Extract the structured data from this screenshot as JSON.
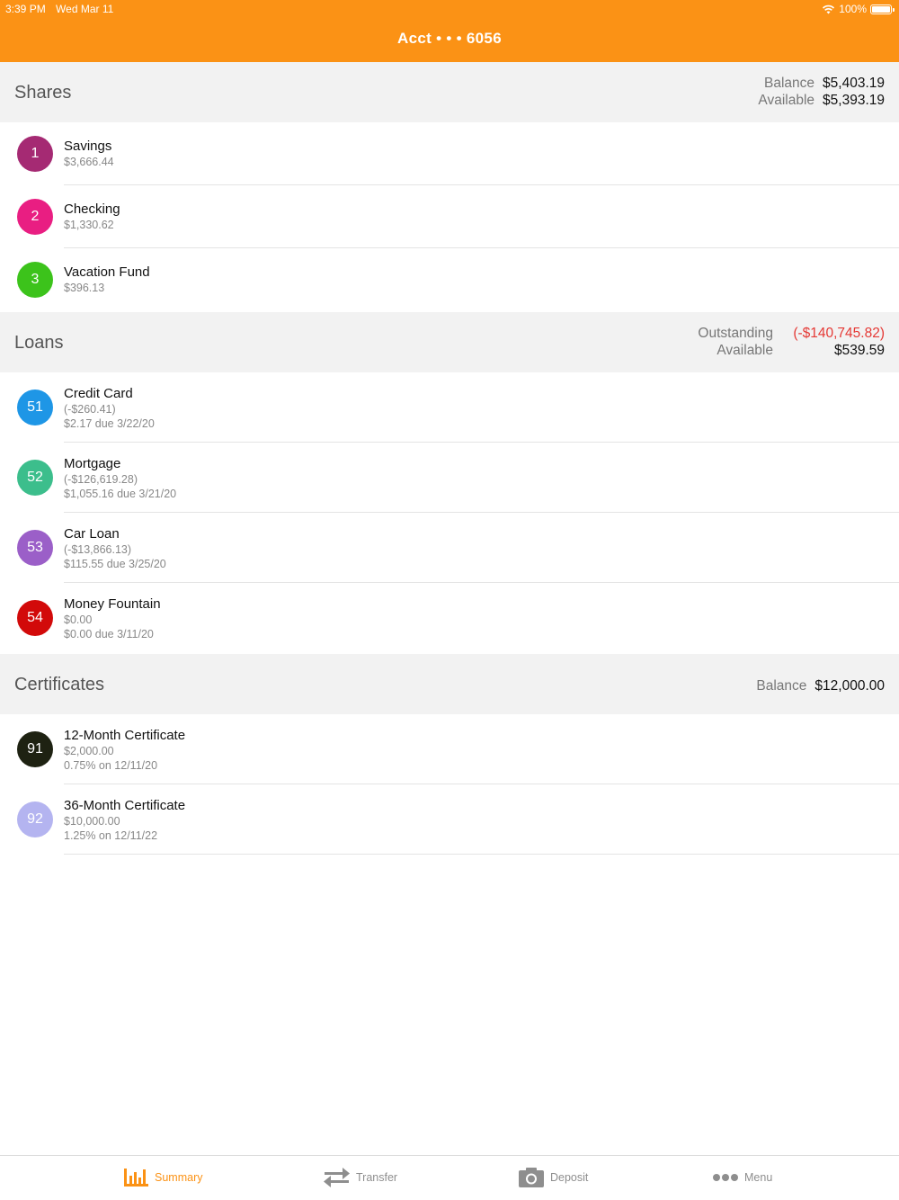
{
  "status_bar": {
    "time": "3:39 PM",
    "date": "Wed Mar 11",
    "battery": "100%"
  },
  "header": {
    "title": "Acct • • • 6056"
  },
  "colors": {
    "accent": "#fb9215",
    "negative": "#e53935"
  },
  "shares": {
    "title": "Shares",
    "balance_label": "Balance",
    "balance_value": "$5,403.19",
    "available_label": "Available",
    "available_value": "$5,393.19",
    "items": [
      {
        "num": "1",
        "name": "Savings",
        "line1": "$3,666.44",
        "color": "#a52a73"
      },
      {
        "num": "2",
        "name": "Checking",
        "line1": "$1,330.62",
        "color": "#e91e82"
      },
      {
        "num": "3",
        "name": "Vacation Fund",
        "line1": "$396.13",
        "color": "#3cc31b"
      }
    ]
  },
  "loans": {
    "title": "Loans",
    "outstanding_label": "Outstanding",
    "outstanding_value": "(-$140,745.82)",
    "available_label": "Available",
    "available_value": "$539.59",
    "items": [
      {
        "num": "51",
        "name": "Credit Card",
        "line1": "(-$260.41)",
        "line2": "$2.17 due 3/22/20",
        "color": "#1e96e6"
      },
      {
        "num": "52",
        "name": "Mortgage",
        "line1": "(-$126,619.28)",
        "line2": "$1,055.16 due 3/21/20",
        "color": "#3cbe8c"
      },
      {
        "num": "53",
        "name": "Car Loan",
        "line1": "(-$13,866.13)",
        "line2": "$115.55 due 3/25/20",
        "color": "#9b5fc8"
      },
      {
        "num": "54",
        "name": "Money Fountain",
        "line1": "$0.00",
        "line2": "$0.00 due 3/11/20",
        "color": "#d20a0a"
      }
    ]
  },
  "certificates": {
    "title": "Certificates",
    "balance_label": "Balance",
    "balance_value": "$12,000.00",
    "items": [
      {
        "num": "91",
        "name": "12-Month Certificate",
        "line1": "$2,000.00",
        "line2": "0.75% on 12/11/20",
        "color": "#1e2212"
      },
      {
        "num": "92",
        "name": "36-Month Certificate",
        "line1": "$10,000.00",
        "line2": "1.25% on 12/11/22",
        "color": "#b4b4f0"
      }
    ]
  },
  "tabs": [
    {
      "label": "Summary",
      "icon": "bar-chart-icon",
      "active": true
    },
    {
      "label": "Transfer",
      "icon": "transfer-arrows-icon",
      "active": false
    },
    {
      "label": "Deposit",
      "icon": "camera-icon",
      "active": false
    },
    {
      "label": "Menu",
      "icon": "more-dots-icon",
      "active": false
    }
  ]
}
